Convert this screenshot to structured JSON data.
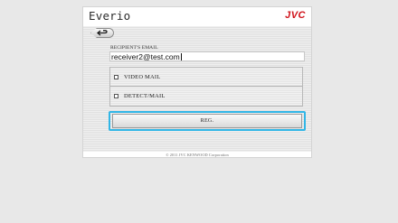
{
  "header": {
    "brand": "Everio",
    "logo": "JVC"
  },
  "toolbar": {
    "back_icon": "return-arrow-icon"
  },
  "form": {
    "email_label": "RECIPIENT'S EMAIL",
    "email_value": "receiver2@test.com",
    "options": [
      {
        "label": "VIDEO MAIL",
        "checked": false
      },
      {
        "label": "DETECT/MAIL",
        "checked": false
      }
    ],
    "register_label": "REG."
  },
  "footer": {
    "copyright": "© 2011 JVC KENWOOD Corporation"
  },
  "colors": {
    "logo": "#d0121a",
    "focus_ring": "#31b6e6",
    "page_background": "#e8e8e8"
  }
}
